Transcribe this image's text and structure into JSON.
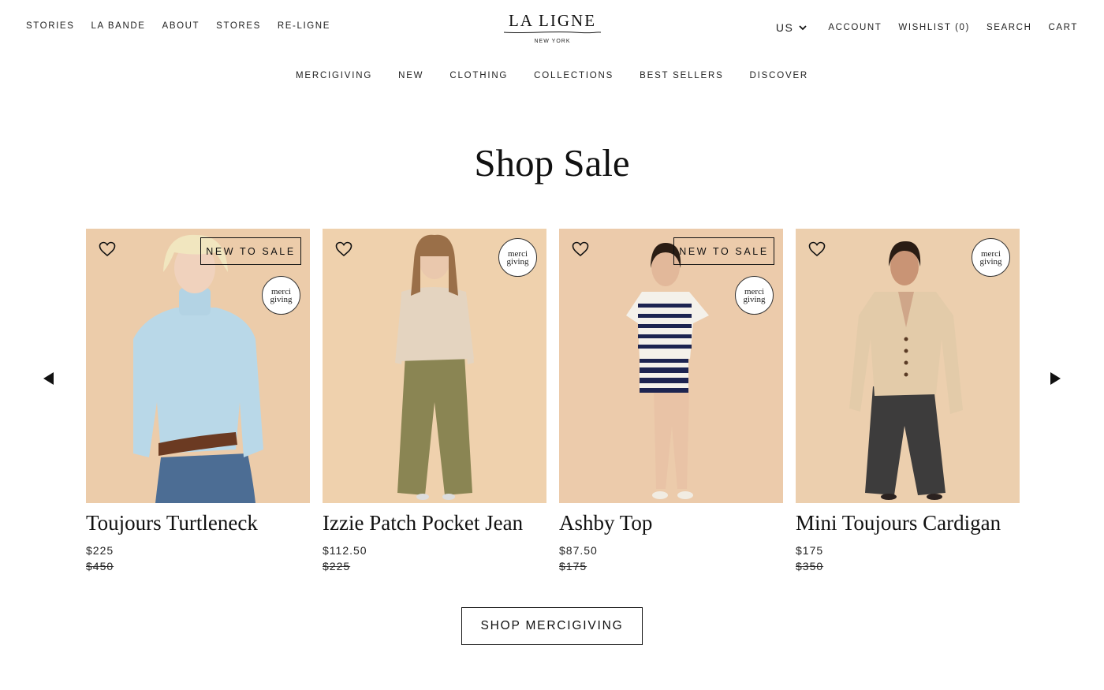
{
  "header": {
    "left_nav": [
      "STORIES",
      "LA BANDE",
      "ABOUT",
      "STORES",
      "RE-LIGNE"
    ],
    "logo": {
      "name": "LA LIGNE",
      "subtitle": "NEW YORK"
    },
    "country": "US",
    "account": "ACCOUNT",
    "wishlist": "WISHLIST (0)",
    "search": "SEARCH",
    "cart": "CART"
  },
  "main_nav": [
    "MERCIGIVING",
    "NEW",
    "CLOTHING",
    "COLLECTIONS",
    "BEST SELLERS",
    "DISCOVER"
  ],
  "section_title": "Shop Sale",
  "badges": {
    "new_to_sale": "NEW TO SALE",
    "merci_line1": "merci",
    "merci_line2": "giving"
  },
  "products": [
    {
      "name": "Toujours Turtleneck",
      "price": "$225",
      "original_price": "$450",
      "new_to_sale": true
    },
    {
      "name": "Izzie Patch Pocket Jean",
      "price": "$112.50",
      "original_price": "$225",
      "new_to_sale": false
    },
    {
      "name": "Ashby Top",
      "price": "$87.50",
      "original_price": "$175",
      "new_to_sale": true
    },
    {
      "name": "Mini Toujours Cardigan",
      "price": "$175",
      "original_price": "$350",
      "new_to_sale": false
    }
  ],
  "cta": "SHOP MERCIGIVING",
  "colors": {
    "photo_background": "#eccda9",
    "text": "#111111"
  },
  "icons": {
    "wishlist_item": "heart-outline-icon",
    "carousel_prev": "triangle-left-icon",
    "carousel_next": "triangle-right-icon",
    "country_dropdown": "chevron-down-icon"
  }
}
